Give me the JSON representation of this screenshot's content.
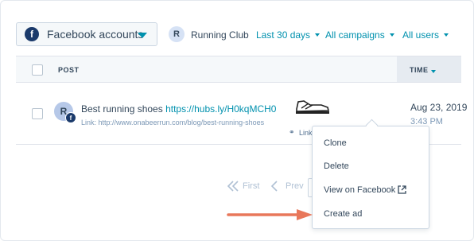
{
  "filters": {
    "account_label": "Facebook accounts",
    "account_badge": "f",
    "club_initial": "R",
    "club_name": "Running Club",
    "date_range": "Last 30 days",
    "campaigns": "All campaigns",
    "users": "All users"
  },
  "table": {
    "columns": [
      "POST",
      "TIME"
    ],
    "rows": [
      {
        "avatar_initial": "R",
        "fb_badge": "f",
        "text": "Best running shoes ",
        "link": "https://hubs.ly/H0kqMCH0",
        "url_line": "Link: http://www.onabeerrun.com/blog/best-running-shoes",
        "type_label": "Link",
        "date": "Aug 23, 2019",
        "time": "3:43 PM"
      }
    ]
  },
  "pagination": {
    "first": "First",
    "prev": "Prev"
  },
  "menu": {
    "items": [
      "Clone",
      "Delete",
      "View on Facebook",
      "Create ad"
    ]
  },
  "colors": {
    "accent": "#0091ae",
    "arrow": "#e8775a",
    "facebook": "#1b3a6b"
  }
}
